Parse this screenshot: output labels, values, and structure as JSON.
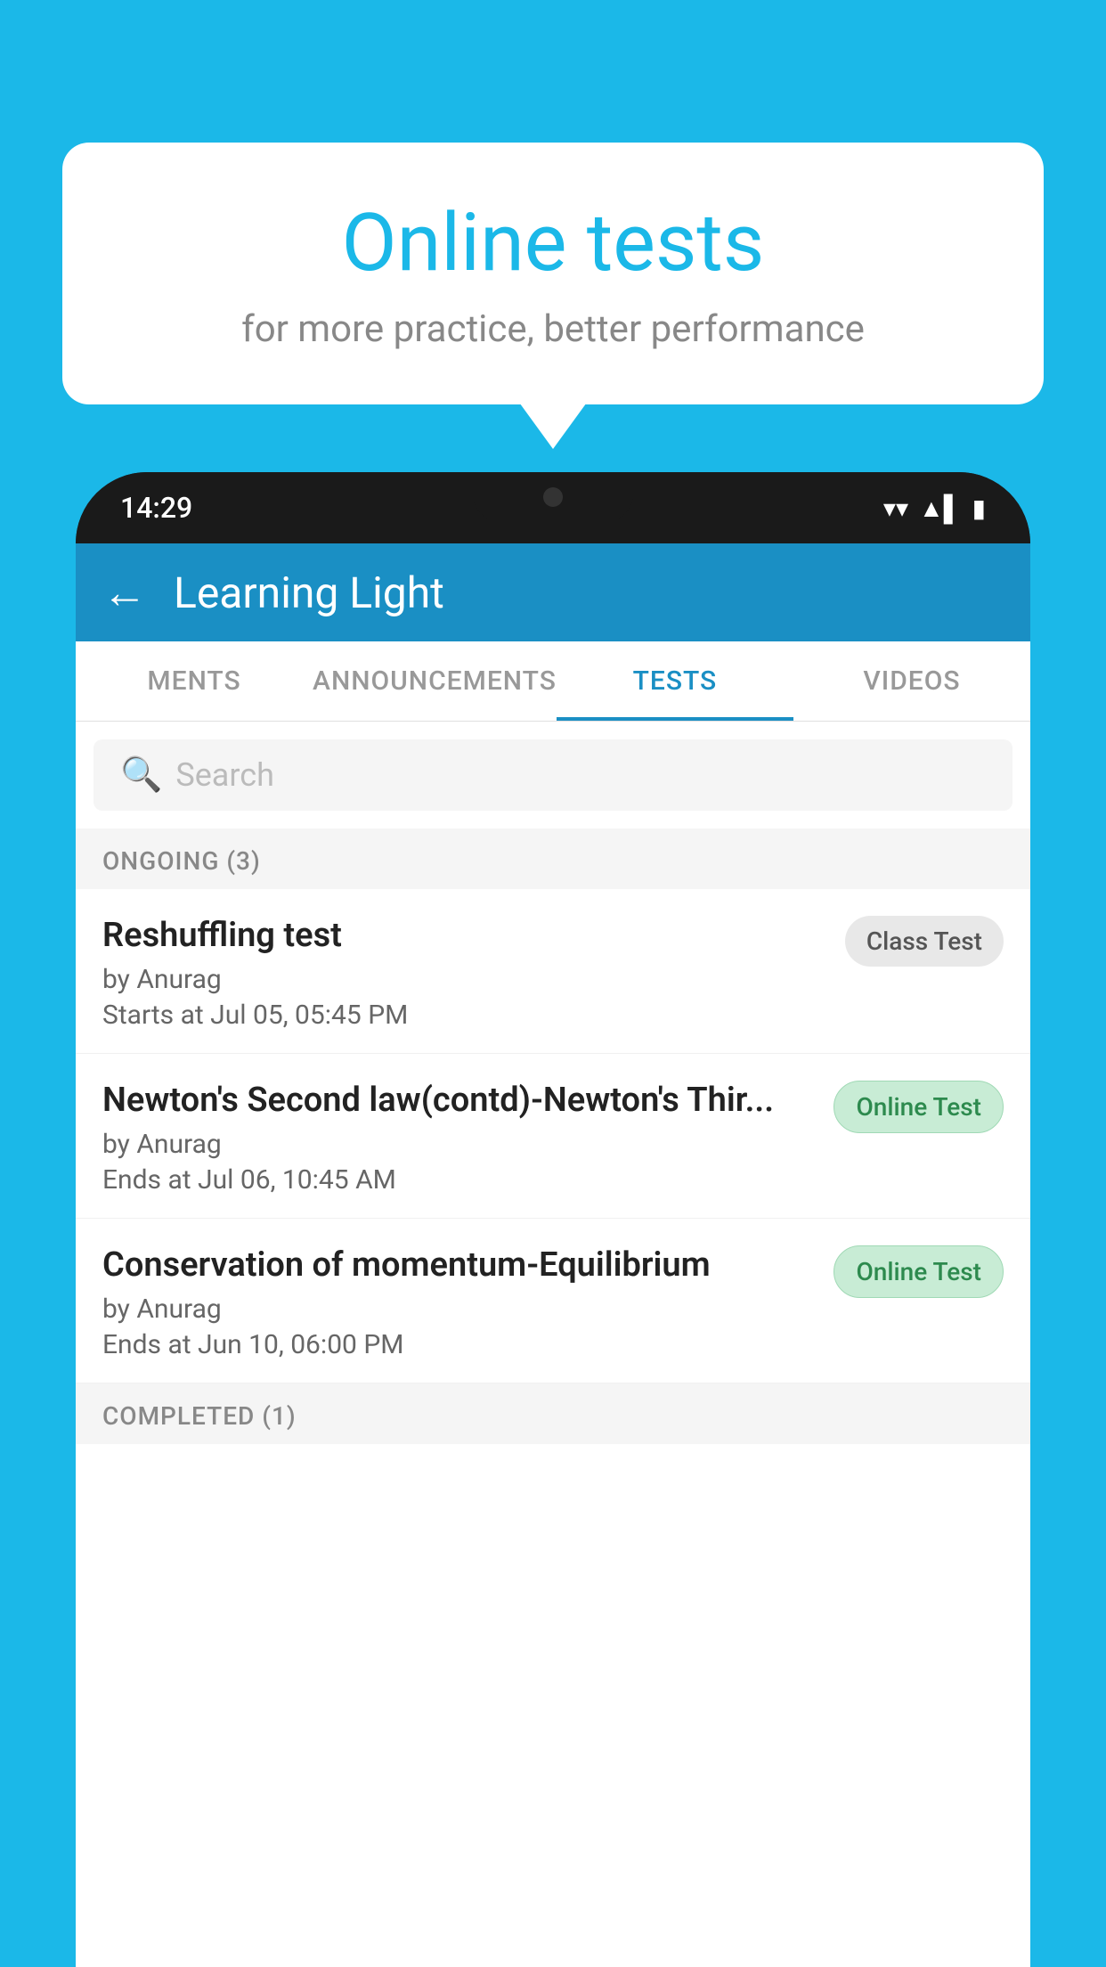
{
  "background_color": "#1bb8e8",
  "bubble": {
    "title": "Online tests",
    "subtitle": "for more practice, better performance"
  },
  "phone": {
    "status_bar": {
      "time": "14:29",
      "wifi_icon": "▼",
      "signal_icon": "▲",
      "battery_icon": "▮"
    },
    "app_bar": {
      "back_label": "←",
      "title": "Learning Light"
    },
    "tabs": [
      {
        "label": "MENTS",
        "active": false
      },
      {
        "label": "ANNOUNCEMENTS",
        "active": false
      },
      {
        "label": "TESTS",
        "active": true
      },
      {
        "label": "VIDEOS",
        "active": false
      }
    ],
    "search": {
      "placeholder": "Search"
    },
    "sections": [
      {
        "header": "ONGOING (3)",
        "items": [
          {
            "name": "Reshuffling test",
            "author": "by Anurag",
            "date": "Starts at  Jul 05, 05:45 PM",
            "badge": "Class Test",
            "badge_type": "class"
          },
          {
            "name": "Newton's Second law(contd)-Newton's Thir...",
            "author": "by Anurag",
            "date": "Ends at  Jul 06, 10:45 AM",
            "badge": "Online Test",
            "badge_type": "online"
          },
          {
            "name": "Conservation of momentum-Equilibrium",
            "author": "by Anurag",
            "date": "Ends at  Jun 10, 06:00 PM",
            "badge": "Online Test",
            "badge_type": "online"
          }
        ]
      }
    ],
    "completed_header": "COMPLETED (1)"
  }
}
